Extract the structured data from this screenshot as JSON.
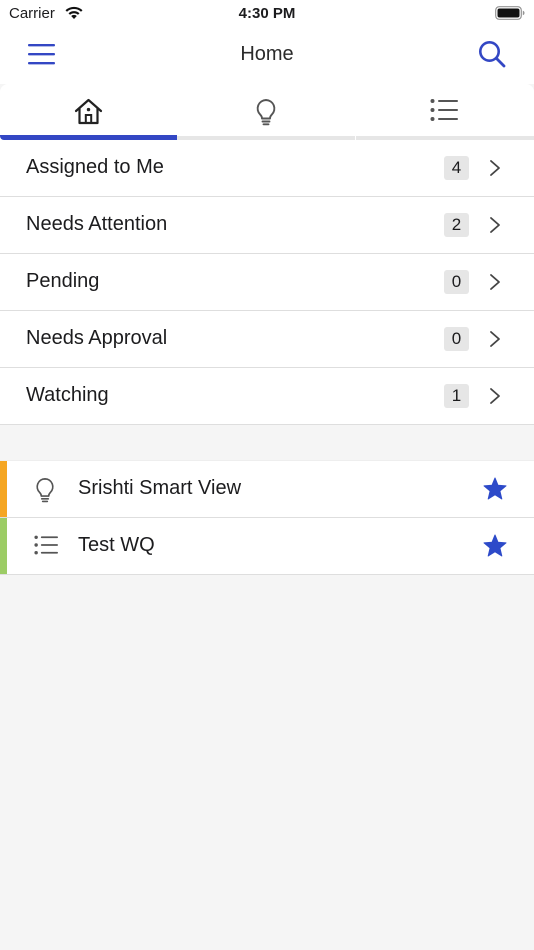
{
  "status_bar": {
    "carrier": "Carrier",
    "time": "4:30 PM",
    "icons": [
      "wifi-icon",
      "battery-icon"
    ]
  },
  "nav": {
    "title": "Home",
    "left_icon": "hamburger-menu-icon",
    "right_icon": "search-icon"
  },
  "tabs": [
    {
      "icon": "home-icon",
      "selected": true
    },
    {
      "icon": "lightbulb-icon",
      "selected": false
    },
    {
      "icon": "list-icon",
      "selected": false
    }
  ],
  "inbox": {
    "items": [
      {
        "label": "Assigned to Me",
        "count": "4"
      },
      {
        "label": "Needs Attention",
        "count": "2"
      },
      {
        "label": "Pending",
        "count": "0"
      },
      {
        "label": "Needs Approval",
        "count": "0"
      },
      {
        "label": "Watching",
        "count": "1"
      }
    ]
  },
  "favorites": {
    "items": [
      {
        "label": "Srishti Smart View",
        "icon": "lightbulb-icon",
        "accent": "#f5a623",
        "starred": true
      },
      {
        "label": "Test WQ",
        "icon": "list-icon",
        "accent": "#9ccc65",
        "starred": true
      }
    ]
  },
  "colors": {
    "accent": "#3347c4",
    "star": "#2d4ac9",
    "background": "#f5f5f5"
  }
}
